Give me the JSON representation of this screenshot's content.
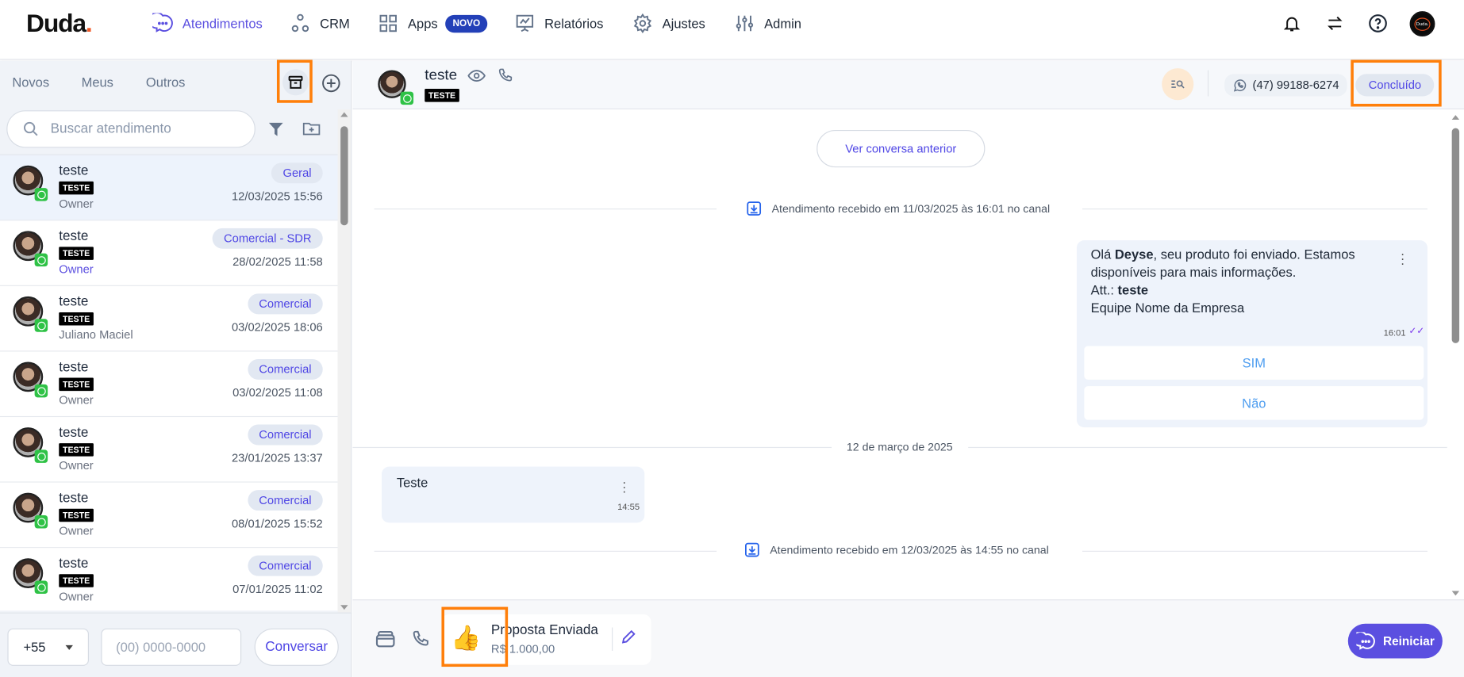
{
  "brand": {
    "name": "Duda",
    "dot": "."
  },
  "nav": {
    "items": [
      {
        "label": "Atendimentos",
        "icon": "chat-icon",
        "active": true
      },
      {
        "label": "CRM",
        "icon": "crm-icon"
      },
      {
        "label": "Apps",
        "icon": "grid-icon",
        "badge": "NOVO"
      },
      {
        "label": "Relatórios",
        "icon": "presentation-chart-icon"
      },
      {
        "label": "Ajustes",
        "icon": "gear-icon"
      },
      {
        "label": "Admin",
        "icon": "sliders-icon"
      }
    ],
    "avatar_text": "Duda."
  },
  "left": {
    "tabs": [
      "Novos",
      "Meus",
      "Outros"
    ],
    "search_placeholder": "Buscar atendimento",
    "items": [
      {
        "name": "teste",
        "tag": "TESTE",
        "sub": "Owner",
        "pill": "Geral",
        "date": "12/03/2025 15:56",
        "selected": true
      },
      {
        "name": "teste",
        "tag": "TESTE",
        "sub": "Owner",
        "pill": "Comercial - SDR",
        "date": "28/02/2025 11:58"
      },
      {
        "name": "teste",
        "tag": "TESTE",
        "sub": "Juliano Maciel",
        "pill": "Comercial",
        "date": "03/02/2025 18:06"
      },
      {
        "name": "teste",
        "tag": "TESTE",
        "sub": "Owner",
        "pill": "Comercial",
        "date": "03/02/2025 11:08"
      },
      {
        "name": "teste",
        "tag": "TESTE",
        "sub": "Owner",
        "pill": "Comercial",
        "date": "23/01/2025 13:37"
      },
      {
        "name": "teste",
        "tag": "TESTE",
        "sub": "Owner",
        "pill": "Comercial",
        "date": "08/01/2025 15:52"
      },
      {
        "name": "teste",
        "tag": "TESTE",
        "sub": "Owner",
        "pill": "Comercial",
        "date": "07/01/2025 11:02"
      }
    ],
    "country_code": "+55",
    "phone_placeholder": "(00) 0000-0000",
    "start_button": "Conversar"
  },
  "chat": {
    "contact_name": "teste",
    "contact_tag": "TESTE",
    "phone": "(47) 99188-6274",
    "status": "Concluído",
    "prev_button": "Ver conversa anterior",
    "sys1": "Atendimento recebido em 11/03/2025 às 16:01 no canal",
    "msg1": {
      "p1": "Olá ",
      "bold1": "Deyse",
      "p2": ", seu produto foi enviado. Estamos disponíveis para mais informações.",
      "att": "Att.: ",
      "bold2": "teste",
      "p3": "Equipe Nome da Empresa",
      "time": "16:01"
    },
    "options": [
      "SIM",
      "Não"
    ],
    "date_sep": "12 de março de 2025",
    "msg2": {
      "text": "Teste",
      "time": "14:55"
    },
    "sys2": "Atendimento recebido em 12/03/2025 às 14:55 no canal"
  },
  "bottom": {
    "deal_title": "Proposta Enviada",
    "deal_value": "R$ 1.000,00",
    "deal_emoji": "👍",
    "restart": "Reiniciar"
  }
}
